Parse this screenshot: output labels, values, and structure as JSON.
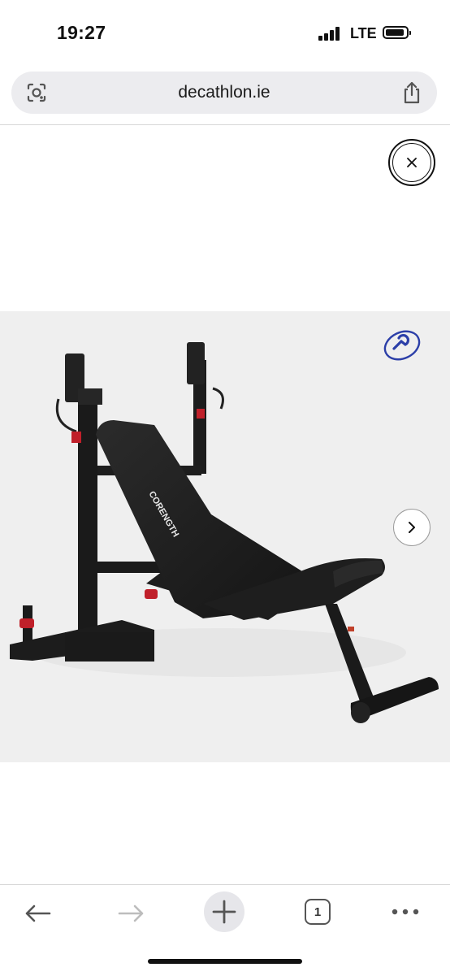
{
  "status_bar": {
    "time": "19:27",
    "network": "LTE",
    "signal_bars": 4,
    "icons": [
      "signal-icon",
      "battery-icon"
    ]
  },
  "browser": {
    "url": "decathlon.ie",
    "icons": [
      "lens-icon",
      "share-icon",
      "close-icon",
      "ar-view-icon",
      "chevron-right-icon"
    ]
  },
  "product": {
    "brand_on_bench": "CORENGTH"
  },
  "toolbar": {
    "tab_count": "1",
    "icons": [
      "back-arrow-icon",
      "forward-arrow-icon",
      "new-tab-plus-icon",
      "tabs-icon",
      "more-dots-icon"
    ]
  }
}
